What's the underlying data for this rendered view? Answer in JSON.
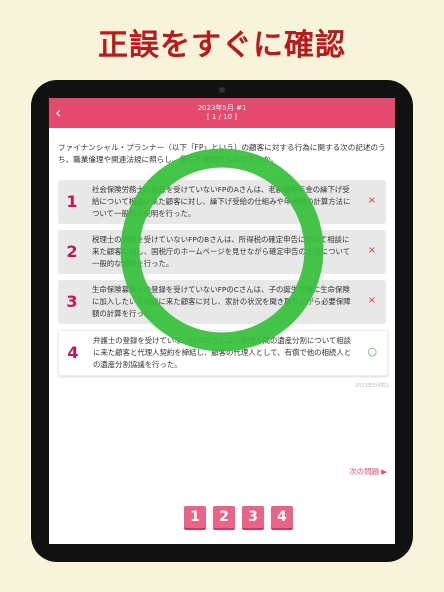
{
  "headline": "正誤をすぐに確認",
  "header": {
    "title": "2023年5月 #1",
    "progress": "[ 1 / 10 ]",
    "back_icon": "chevron-left-icon"
  },
  "question": "ファイナンシャル・プランナー（以下「FP」という）の顧客に対する行為に関する次の記述のうち、職業倫理や関連法規に照らし、最も不適切なものはどれか。",
  "choices": [
    {
      "number": "1",
      "text": "社会保険労務士の登録を受けていないFPのAさんは、老齢基礎年金の繰下げ受給について相談に来た顧客に対し、繰下げ受給の仕組みや年金額の計算方法について一般的な説明を行った。",
      "mark": "×",
      "correct": false
    },
    {
      "number": "2",
      "text": "税理士の登録を受けていないFPのBさんは、所得税の確定申告について相談に来た顧客に対し、国税庁のホームページを見せながら確定申告の方法について一般的な説明を行った。",
      "mark": "×",
      "correct": false
    },
    {
      "number": "3",
      "text": "生命保険募集人の登録を受けていないFPのCさんは、子の誕生を機に生命保険に加入したいと相談に来た顧客に対し、家計の状況を聞き取りながら必要保障額の計算を行った。",
      "mark": "×",
      "correct": false
    },
    {
      "number": "4",
      "text": "弁護士の登録を受けていないFPのDさんは、相続人間の遺産分割について相談に来た顧客と代理人契約を締結し、顧客の代理人として、有償で他の相続人との遺産分割協議を行った。",
      "mark": "○",
      "correct": true
    }
  ],
  "footnote": "2023年5月問1",
  "next_label": "次の問題 ▶",
  "answer_buttons": [
    "1",
    "2",
    "3",
    "4"
  ],
  "colors": {
    "accent": "#e54a6e",
    "headline": "#b71c1c",
    "correct_ring": "#34c03a",
    "wrong_mark": "#e53935",
    "right_mark": "#4caf50"
  }
}
